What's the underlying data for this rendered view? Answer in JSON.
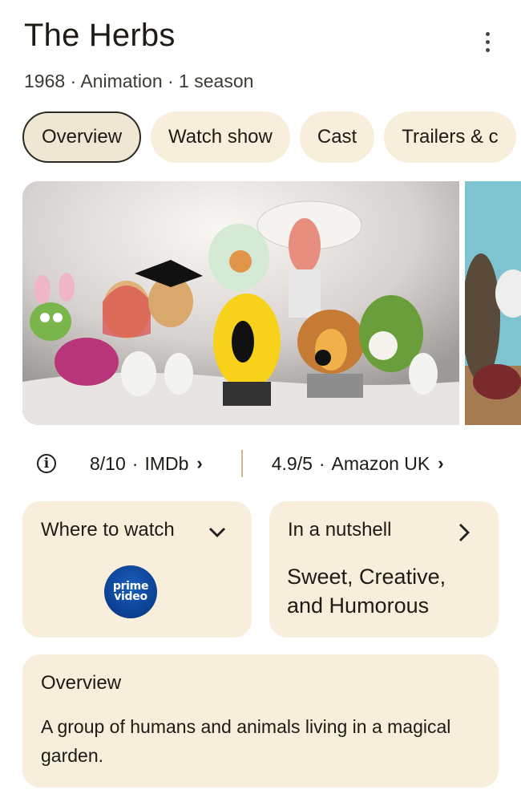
{
  "header": {
    "title": "The Herbs",
    "subtitle": "1968 · Animation · 1 season",
    "more_icon": "more-vert-icon"
  },
  "tabs": [
    {
      "label": "Overview",
      "active": true
    },
    {
      "label": "Watch show",
      "active": false
    },
    {
      "label": "Cast",
      "active": false
    },
    {
      "label": "Trailers & c",
      "active": false
    }
  ],
  "ratings": {
    "info_icon": "info-icon",
    "imdb": {
      "score": "8/10",
      "source": "IMDb",
      "chevron": "›"
    },
    "amazon": {
      "score": "4.9/5",
      "source": "Amazon UK",
      "chevron": "›"
    }
  },
  "where_to_watch": {
    "title": "Where to watch",
    "provider_line1": "prime",
    "provider_line2": "video"
  },
  "nutshell": {
    "title": "In a nutshell",
    "text": "Sweet, Creative, and Humorous"
  },
  "overview": {
    "title": "Overview",
    "text": "A group of humans and animals living in a magical garden."
  },
  "colors": {
    "card_bg": "#f7eedb",
    "chip_active_border": "#2c2a25",
    "divider": "#cbb98a"
  }
}
